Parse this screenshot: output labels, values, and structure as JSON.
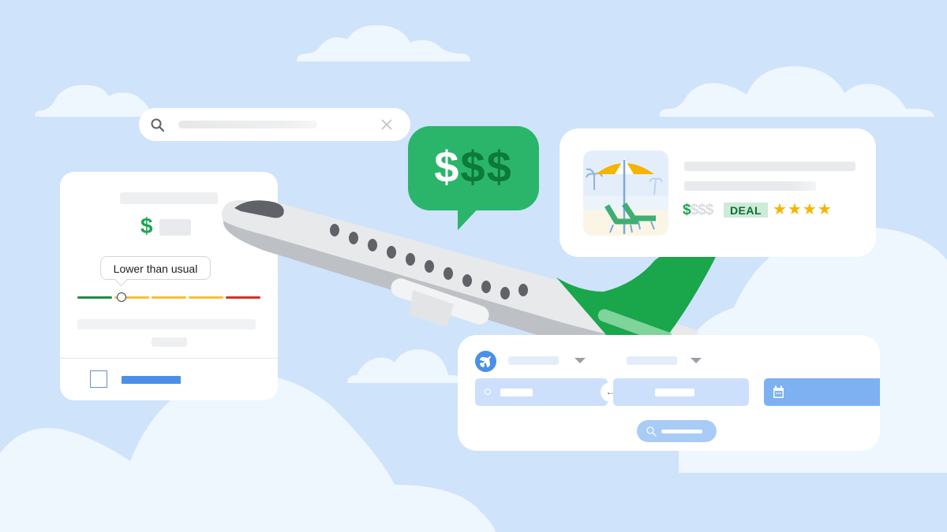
{
  "scene": "Google Flights price insight illustration",
  "colors": {
    "sky": "#cfe3fb",
    "cloud": "#eef6fe",
    "card": "#ffffff",
    "placeholder": "#e8eaed",
    "green": "#1ea44f",
    "green_dark": "#0d7a38",
    "bubble_green": "#2bb56b",
    "blue": "#4a90e8",
    "light_blue": "#cce0fb",
    "yellow": "#f5c033",
    "red": "#d93025",
    "star": "#f5b400"
  },
  "search_bar": {
    "search_icon": "search-icon",
    "clear_icon": "close-icon",
    "value": ""
  },
  "price_card": {
    "currency_symbol": "$",
    "tooltip": "Lower than usual",
    "price_level": "low",
    "meter_segments": [
      "green",
      "yellow",
      "yellow",
      "yellow",
      "red"
    ],
    "meter_position": 0.24,
    "checkbox_checked": false
  },
  "speech_bubble": {
    "symbols": [
      "$",
      "$",
      "$"
    ],
    "highlighted_count": 1
  },
  "hotel_card": {
    "price_symbols": [
      "$",
      "$",
      "$",
      "$"
    ],
    "price_level": 1,
    "badge": "DEAL",
    "stars": 4,
    "star_glyph": "★"
  },
  "flight_search": {
    "trip_type_icon": "airplane-icon",
    "swap_icon": "←",
    "origin_icon": "circle-icon",
    "date_icon": "calendar-icon",
    "search_icon": "search-icon"
  }
}
